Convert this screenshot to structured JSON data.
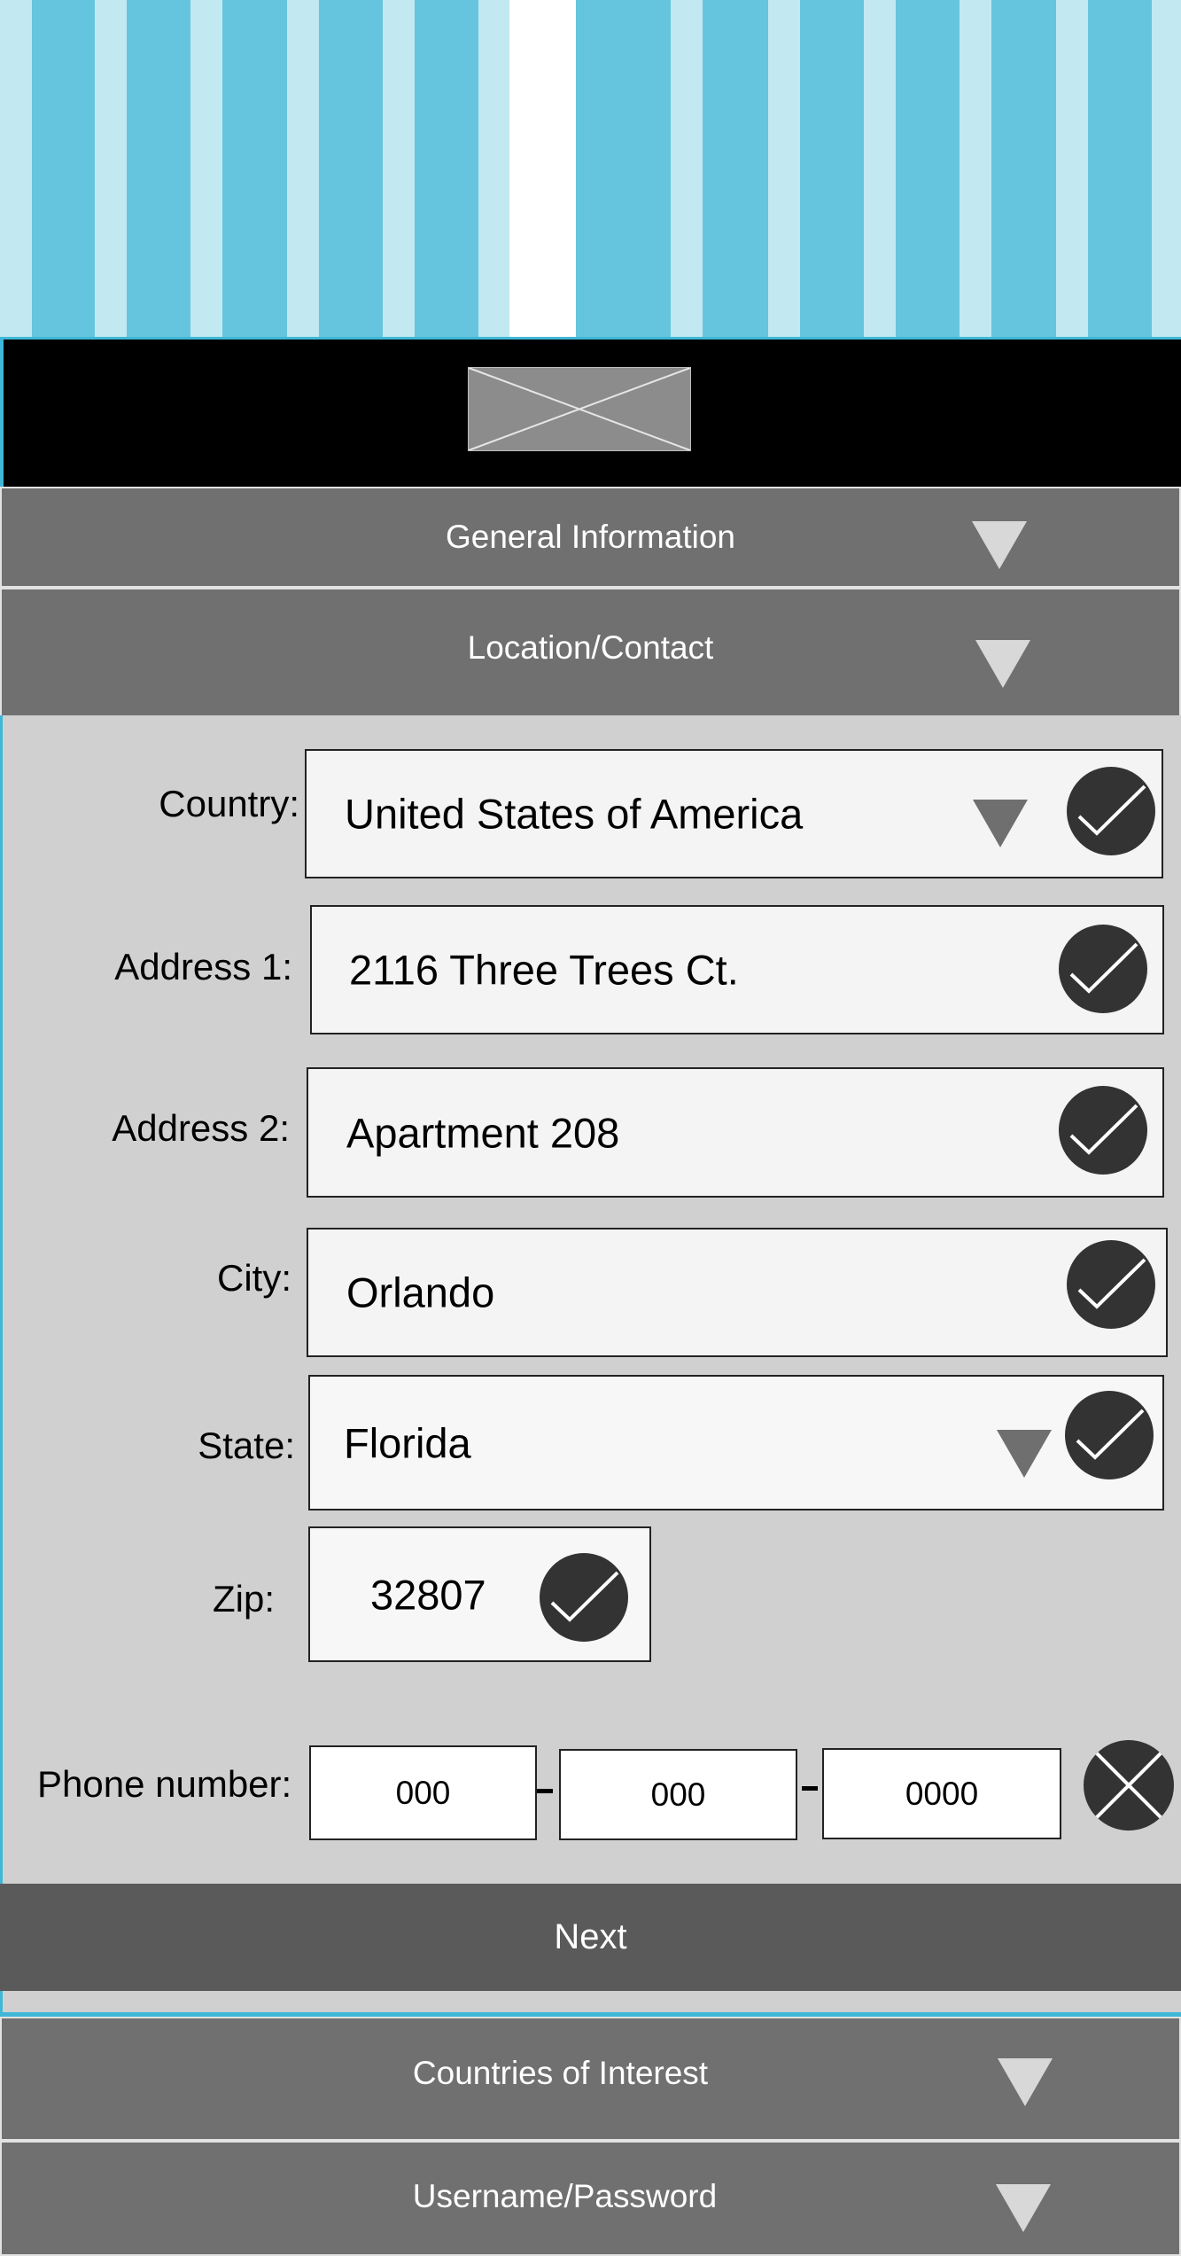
{
  "accordion": {
    "general_information": "General Information",
    "location_contact": "Location/Contact",
    "countries_of_interest": "Countries of Interest",
    "username_password": "Username/Password"
  },
  "form": {
    "country": {
      "label": "Country:",
      "value": "United States of America"
    },
    "address1": {
      "label": "Address 1:",
      "value": "2116 Three Trees Ct."
    },
    "address2": {
      "label": "Address 2:",
      "value": "Apartment 208"
    },
    "city": {
      "label": "City:",
      "value": "Orlando"
    },
    "state": {
      "label": "State:",
      "value": "Florida"
    },
    "zip": {
      "label": "Zip:",
      "value": "32807"
    },
    "phone": {
      "label": "Phone number:",
      "part1": "000",
      "part2": "000",
      "part3": "0000"
    }
  },
  "next_label": "Next",
  "icons": {
    "valid": "checkmark-circle-icon",
    "invalid": "x-circle-icon",
    "dropdown": "triangle-down-icon",
    "placeholder": "image-placeholder-icon"
  },
  "colors": {
    "banner": "#66c5de",
    "banner_stripe": "#c2e8f1",
    "accent": "#3fb7d7",
    "accordion": "#707070",
    "form_bg": "#d0d0d0",
    "next_button": "#5b5a5b",
    "check_circle": "#333333"
  }
}
